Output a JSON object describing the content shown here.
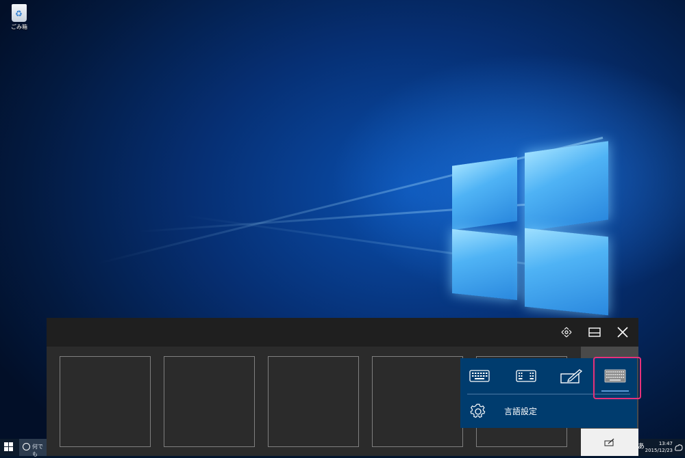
{
  "desktop": {
    "recycle_bin_label": "ごみ箱"
  },
  "taskbar": {
    "search_placeholder": "何でも",
    "ime_indicator": "あ",
    "time": "13:47",
    "date": "2015/12/23"
  },
  "touch_keyboard": {
    "toolbar_icons": [
      "move-handle-icon",
      "dock-keyboard-icon",
      "close-icon"
    ],
    "candidate_count": 5,
    "side_button_icon": "handwriting-icon"
  },
  "keyboard_layout_menu": {
    "layout_icons": [
      "standard-keyboard-icon",
      "split-keyboard-icon",
      "handwriting-pen-icon",
      "full-keyboard-icon"
    ],
    "selected_layout": "full-keyboard-icon",
    "language_settings_label": "言語設定",
    "highlight_color": "#e8317a",
    "menu_bg": "#003c6e"
  }
}
